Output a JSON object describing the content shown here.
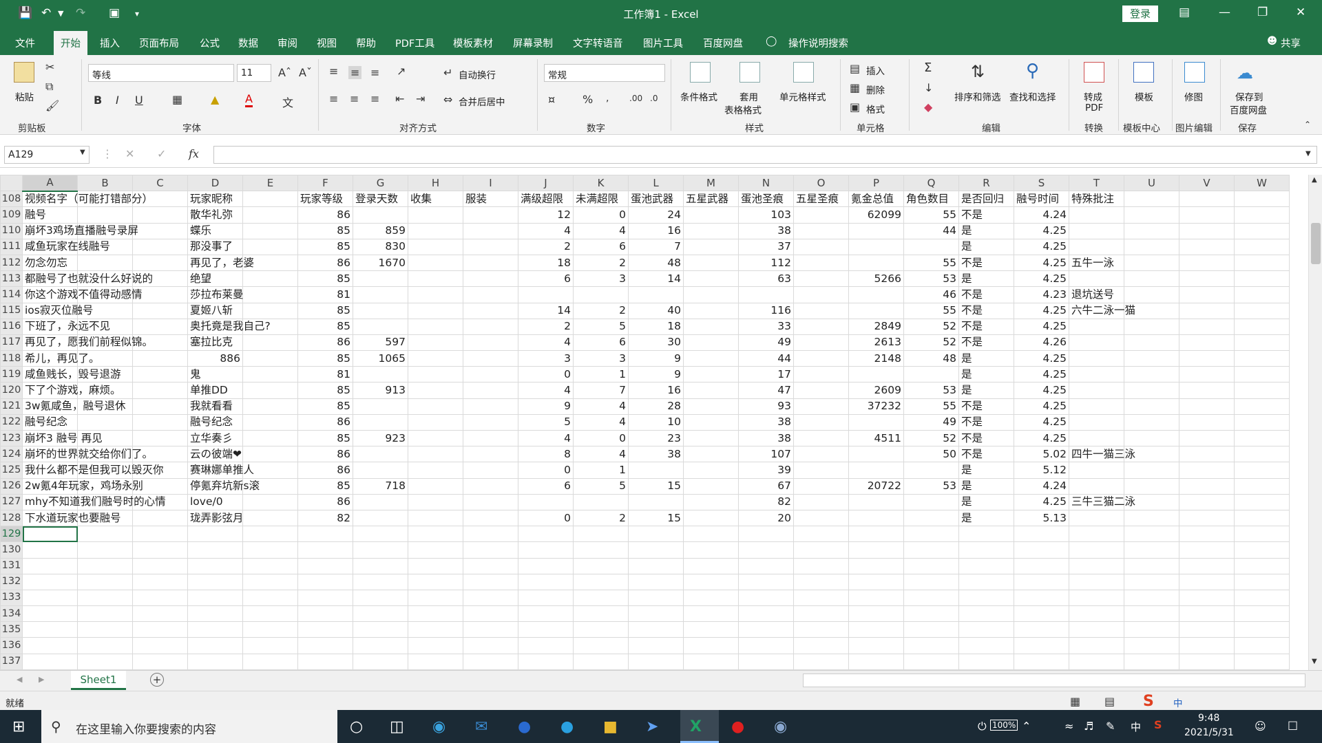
{
  "window": {
    "title": "工作簿1  -  Excel",
    "login": "登录"
  },
  "menu": {
    "tabs": [
      "文件",
      "开始",
      "插入",
      "页面布局",
      "公式",
      "数据",
      "审阅",
      "视图",
      "帮助",
      "PDF工具",
      "模板素材",
      "屏幕录制",
      "文字转语音",
      "图片工具",
      "百度网盘"
    ],
    "tell_me": "操作说明搜索",
    "share": "共享"
  },
  "ribbon": {
    "paste": "粘贴",
    "clipboard": "剪贴板",
    "font_name": "等线",
    "font_size": "11",
    "font_group": "字体",
    "wrap_text": "自动换行",
    "merge_center": "合并后居中",
    "align_group": "对齐方式",
    "number_format": "常规",
    "number_group": "数字",
    "cond_format": "条件格式",
    "table_format_1": "套用",
    "table_format_2": "表格格式",
    "cell_styles": "单元格样式",
    "styles_group": "样式",
    "insert": "插入",
    "delete": "删除",
    "format": "格式",
    "cells_group": "单元格",
    "sort_filter": "排序和筛选",
    "find_select": "查找和选择",
    "edit_group": "编辑",
    "to_pdf_1": "转成",
    "to_pdf_2": "PDF",
    "convert_group": "转换",
    "templates": "模板",
    "template_center": "模板中心",
    "retouch": "修图",
    "image_edit": "图片编辑",
    "save_baidu_1": "保存到",
    "save_baidu_2": "百度网盘",
    "save_group": "保存"
  },
  "formula_bar": {
    "name_box": "A129",
    "fx": "fx"
  },
  "columns": [
    "A",
    "B",
    "C",
    "D",
    "E",
    "F",
    "G",
    "H",
    "I",
    "J",
    "K",
    "L",
    "M",
    "N",
    "O",
    "P",
    "Q",
    "R",
    "S",
    "T",
    "U",
    "V",
    "W"
  ],
  "rows": [
    {
      "n": "108",
      "a": "视频名字（可能打错部分）",
      "d": "玩家昵称",
      "f": "玩家等级",
      "g": "登录天数",
      "h": "收集",
      "i": "服装",
      "j": "满级超限",
      "k": "未满超限",
      "l": "蛋池武器",
      "m": "五星武器",
      "nn": "蛋池圣痕",
      "o": "五星圣痕",
      "p": "氪金总值",
      "q": "角色数目",
      "r": "是否回归",
      "s": "融号时间",
      "t": "特殊批注",
      "hdr": true
    },
    {
      "n": "109",
      "a": "融号",
      "d": "散华礼弥",
      "f": "86",
      "j": "12",
      "k": "0",
      "l": "24",
      "nn": "103",
      "p": "62099",
      "q": "55",
      "r": "不是",
      "s": "4.24"
    },
    {
      "n": "110",
      "a": "崩坏3鸡场直播融号录屏",
      "d": "蝶乐",
      "f": "85",
      "g": "859",
      "j": "4",
      "k": "4",
      "l": "16",
      "nn": "38",
      "q": "44",
      "r": "是",
      "s": "4.25"
    },
    {
      "n": "111",
      "a": "咸鱼玩家在线融号",
      "d": "那没事了",
      "f": "85",
      "g": "830",
      "j": "2",
      "k": "6",
      "l": "7",
      "nn": "37",
      "r": "是",
      "s": "4.25"
    },
    {
      "n": "112",
      "a": "勿念勿忘",
      "d": "再见了，老婆",
      "f": "86",
      "g": "1670",
      "j": "18",
      "k": "2",
      "l": "48",
      "nn": "112",
      "q": "55",
      "r": "不是",
      "s": "4.25",
      "t": "五牛一泳"
    },
    {
      "n": "113",
      "a": "都融号了也就没什么好说的",
      "d": "绝望",
      "f": "85",
      "j": "6",
      "k": "3",
      "l": "14",
      "nn": "63",
      "p": "5266",
      "q": "53",
      "r": "是",
      "s": "4.25"
    },
    {
      "n": "114",
      "a": "你这个游戏不值得动感情",
      "d": "莎拉布莱曼",
      "f": "81",
      "q": "46",
      "r": "不是",
      "s": "4.23",
      "t": "退坑送号"
    },
    {
      "n": "115",
      "a": "ios寂灭位融号",
      "d": "夏姬八斩",
      "f": "85",
      "j": "14",
      "k": "2",
      "l": "40",
      "nn": "116",
      "q": "55",
      "r": "不是",
      "s": "4.25",
      "t": "六牛二泳一猫"
    },
    {
      "n": "116",
      "a": "下班了，永远不见",
      "d": "奥托竟是我自己?",
      "f": "85",
      "j": "2",
      "k": "5",
      "l": "18",
      "nn": "33",
      "p": "2849",
      "q": "52",
      "r": "不是",
      "s": "4.25"
    },
    {
      "n": "117",
      "a": "再见了，愿我们前程似锦。",
      "d": "塞拉比克",
      "f": "86",
      "g": "597",
      "j": "4",
      "k": "6",
      "l": "30",
      "nn": "49",
      "p": "2613",
      "q": "52",
      "r": "不是",
      "s": "4.26"
    },
    {
      "n": "118",
      "a": "希儿，再见了。",
      "d": "886",
      "dnum": true,
      "f": "85",
      "g": "1065",
      "j": "3",
      "k": "3",
      "l": "9",
      "nn": "44",
      "p": "2148",
      "q": "48",
      "r": "是",
      "s": "4.25"
    },
    {
      "n": "119",
      "a": "咸鱼贱长，毁号退游",
      "d": "鬼",
      "f": "81",
      "j": "0",
      "k": "1",
      "l": "9",
      "nn": "17",
      "r": "是",
      "s": "4.25"
    },
    {
      "n": "120",
      "a": "下了个游戏，麻烦。",
      "d": "单推DD",
      "f": "85",
      "g": "913",
      "j": "4",
      "k": "7",
      "l": "16",
      "nn": "47",
      "p": "2609",
      "q": "53",
      "r": "是",
      "s": "4.25"
    },
    {
      "n": "121",
      "a": "3w氪咸鱼，融号退休",
      "d": "我就看看",
      "f": "85",
      "j": "9",
      "k": "4",
      "l": "28",
      "nn": "93",
      "p": "37232",
      "q": "55",
      "r": "不是",
      "s": "4.25"
    },
    {
      "n": "122",
      "a": "融号纪念",
      "d": "融号纪念",
      "f": "86",
      "j": "5",
      "k": "4",
      "l": "10",
      "nn": "38",
      "q": "49",
      "r": "不是",
      "s": "4.25"
    },
    {
      "n": "123",
      "a": "崩坏3 融号 再见",
      "d": "立华奏彡",
      "f": "85",
      "g": "923",
      "j": "4",
      "k": "0",
      "l": "23",
      "nn": "38",
      "p": "4511",
      "q": "52",
      "r": "不是",
      "s": "4.25"
    },
    {
      "n": "124",
      "a": "崩坏的世界就交给你们了。",
      "d": "云の彼端❤",
      "f": "86",
      "j": "8",
      "k": "4",
      "l": "38",
      "nn": "107",
      "q": "50",
      "r": "不是",
      "s": "5.02",
      "t": "四牛一猫三泳"
    },
    {
      "n": "125",
      "a": "我什么都不是但我可以毁灭你",
      "d": "赛琳娜单推人",
      "f": "86",
      "j": "0",
      "k": "1",
      "nn": "39",
      "r": "是",
      "s": "5.12"
    },
    {
      "n": "126",
      "a": "2w氪4年玩家，鸡场永别",
      "d": "停氪弃坑新s滚",
      "f": "85",
      "g": "718",
      "j": "6",
      "k": "5",
      "l": "15",
      "nn": "67",
      "p": "20722",
      "q": "53",
      "r": "是",
      "s": "4.24"
    },
    {
      "n": "127",
      "a": "mhy不知道我们融号时的心情",
      "d": "love/0",
      "f": "86",
      "nn": "82",
      "r": "是",
      "s": "4.25",
      "t": "三牛三猫二泳"
    },
    {
      "n": "128",
      "a": "下水道玩家也要融号",
      "d": "珑弄影弦月",
      "f": "82",
      "j": "0",
      "k": "2",
      "l": "15",
      "nn": "20",
      "r": "是",
      "s": "5.13"
    },
    {
      "n": "129"
    },
    {
      "n": "130"
    },
    {
      "n": "131"
    },
    {
      "n": "132"
    },
    {
      "n": "133"
    },
    {
      "n": "134"
    },
    {
      "n": "135"
    },
    {
      "n": "136"
    },
    {
      "n": "137"
    }
  ],
  "sheet": {
    "tab": "Sheet1",
    "add": "+"
  },
  "status": {
    "ready": "就绪"
  },
  "taskbar": {
    "search_placeholder": "在这里输入你要搜索的内容",
    "battery": "100%",
    "ime": "中",
    "time": "9:48",
    "date": "2021/5/31"
  }
}
